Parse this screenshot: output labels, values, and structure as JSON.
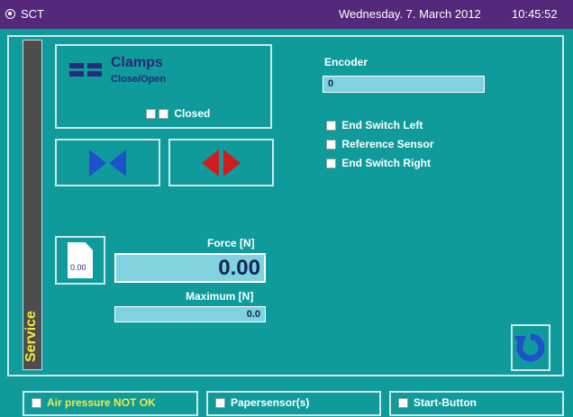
{
  "titlebar": {
    "app_name": "SCT",
    "date": "Wednesday. 7. March 2012",
    "time": "10:45:52"
  },
  "sidebar": {
    "tab_label": "Service"
  },
  "clamps": {
    "title": "Clamps",
    "subtitle": "Close/Open",
    "status": "Closed"
  },
  "encoder": {
    "label": "Encoder",
    "value": "0"
  },
  "switches": [
    {
      "label": "End Switch Left"
    },
    {
      "label": "Reference Sensor"
    },
    {
      "label": "End Switch Right"
    }
  ],
  "force": {
    "doc_value": "0.00",
    "label": "Force [N]",
    "value": "0.00",
    "max_label": "Maximum [N]",
    "max_value": "0.0"
  },
  "bottom": {
    "air_pressure": "Air pressure NOT OK",
    "papersensor": "Papersensor(s)",
    "start_button": "Start-Button"
  },
  "colors": {
    "background": "#0f9b9b",
    "titlebar": "#54287a",
    "field": "#7fd2de",
    "warning_text": "#f2ec3a",
    "arrow_blue": "#1f52c8",
    "arrow_red": "#d01c1c"
  }
}
